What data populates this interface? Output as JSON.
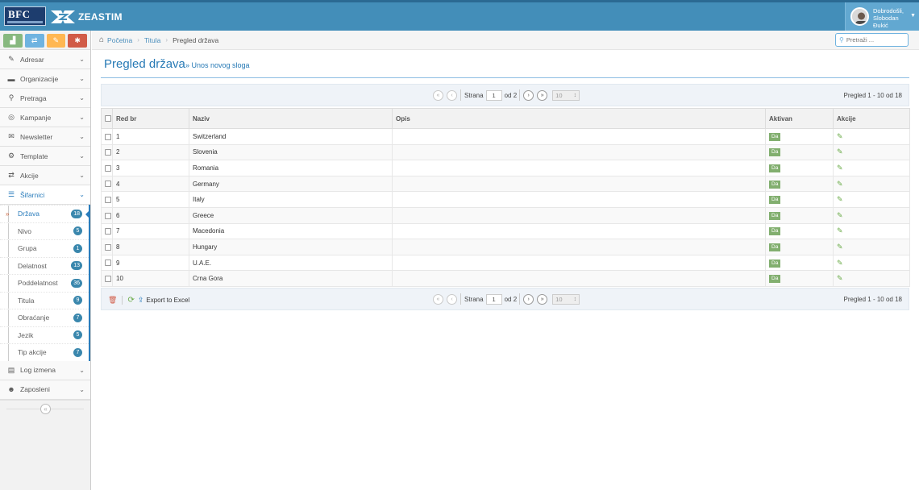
{
  "header": {
    "logo_text": "BFC",
    "brand": "ZEASTIM",
    "user_greeting": "Dobrodošli,",
    "user_first": "Slobodan",
    "user_last": "Đukić"
  },
  "sidebar": {
    "shortcuts": [
      {
        "icon": "chart-icon",
        "color": "#87b87f"
      },
      {
        "icon": "exchange-icon",
        "color": "#6fb3e0"
      },
      {
        "icon": "pencil-icon",
        "color": "#ffb752"
      },
      {
        "icon": "gear-icon",
        "color": "#d15b47"
      }
    ],
    "items": [
      {
        "label": "Adresar",
        "icon": "edit-icon"
      },
      {
        "label": "Organizacije",
        "icon": "briefcase-icon"
      },
      {
        "label": "Pretraga",
        "icon": "search-icon"
      },
      {
        "label": "Kampanje",
        "icon": "target-icon"
      },
      {
        "label": "Newsletter",
        "icon": "envelope-icon"
      },
      {
        "label": "Template",
        "icon": "cogs-icon"
      },
      {
        "label": "Akcije",
        "icon": "exchange-icon"
      },
      {
        "label": "Šifarnici",
        "icon": "list-icon"
      }
    ],
    "submenu": [
      {
        "label": "Država",
        "count": "18",
        "active": true
      },
      {
        "label": "Nivo",
        "count": "5"
      },
      {
        "label": "Grupa",
        "count": "1"
      },
      {
        "label": "Delatnost",
        "count": "13"
      },
      {
        "label": "Poddelatnost",
        "count": "36"
      },
      {
        "label": "Titula",
        "count": "9"
      },
      {
        "label": "Obraćanje",
        "count": "7"
      },
      {
        "label": "Jezik",
        "count": "5"
      },
      {
        "label": "Tip akcije",
        "count": "7"
      }
    ],
    "bottom_items": [
      {
        "label": "Log izmena",
        "icon": "archive-icon"
      },
      {
        "label": "Zaposleni",
        "icon": "users-icon"
      }
    ]
  },
  "breadcrumbs": {
    "home": "Početna",
    "parent": "Titula",
    "current": "Pregled država"
  },
  "search": {
    "placeholder": "Pretraži ..."
  },
  "page": {
    "title": "Pregled država",
    "subtitle": "» Unos novog sloga"
  },
  "pager": {
    "page_label": "Strana",
    "page_value": "1",
    "of_label": "od 2",
    "page_size": "10",
    "info": "Pregled 1 - 10 od 18",
    "export_label": "Export to Excel"
  },
  "grid": {
    "columns": [
      "Red br",
      "Naziv",
      "Opis",
      "Aktivan",
      "Akcije"
    ],
    "active_label": "Da",
    "rows": [
      {
        "n": "1",
        "name": "Switzerland",
        "desc": ""
      },
      {
        "n": "2",
        "name": "Slovenia",
        "desc": ""
      },
      {
        "n": "3",
        "name": "Romania",
        "desc": ""
      },
      {
        "n": "4",
        "name": "Germany",
        "desc": ""
      },
      {
        "n": "5",
        "name": "Italy",
        "desc": ""
      },
      {
        "n": "6",
        "name": "Greece",
        "desc": ""
      },
      {
        "n": "7",
        "name": "Macedonia",
        "desc": ""
      },
      {
        "n": "8",
        "name": "Hungary",
        "desc": ""
      },
      {
        "n": "9",
        "name": "U.A.E.",
        "desc": ""
      },
      {
        "n": "10",
        "name": "Crna Gora",
        "desc": ""
      }
    ]
  }
}
